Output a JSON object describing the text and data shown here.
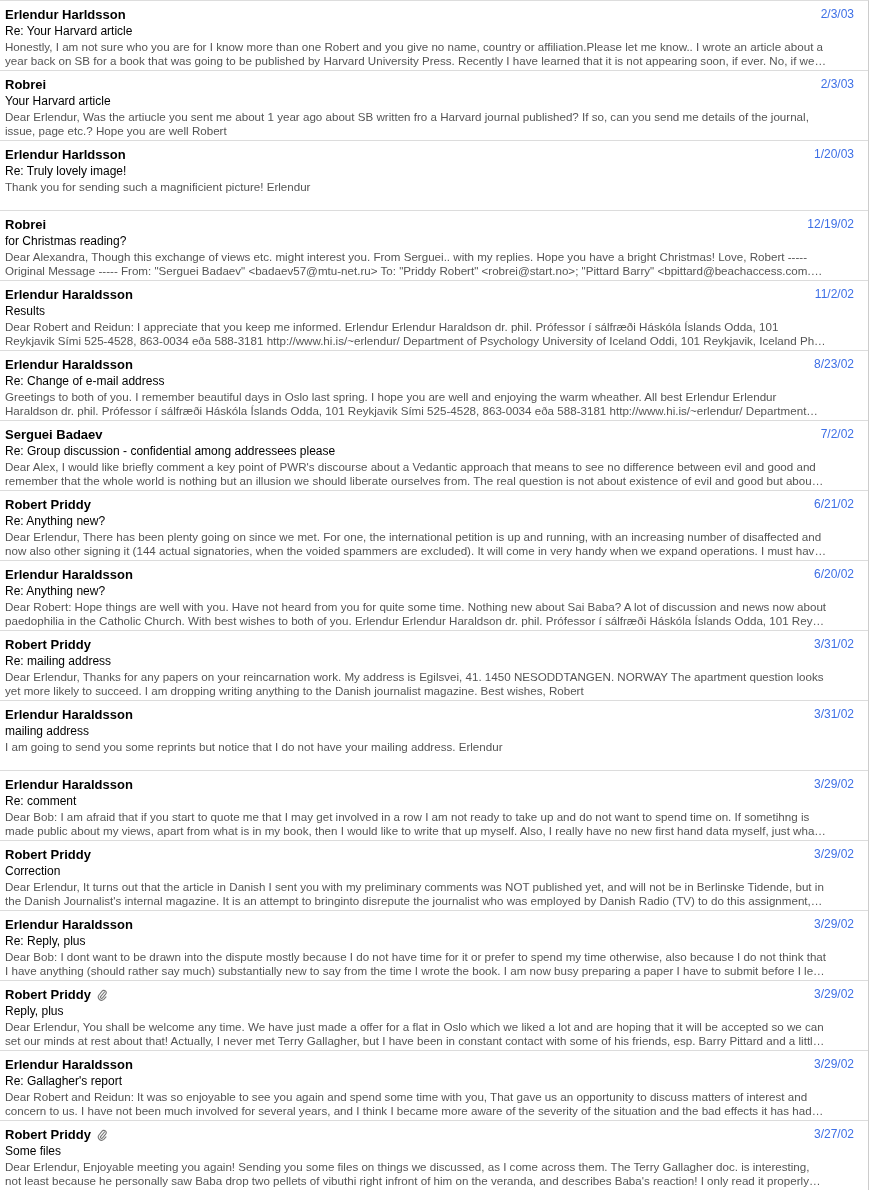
{
  "messages": [
    {
      "sender": "Erlendur Harldsson",
      "attachment": false,
      "date": "2/3/03",
      "subject": "Re: Your Harvard article",
      "preview": [
        "Honestly, I am not sure who you are for I know more than one Robert and you give no name, country or affiliation.Please let me know.. I wrote an article about a",
        "year back on SB for a book that was going to be published by Harvard University Press. Recently I have learned that it is not appearing soon, if ever. No, if we…"
      ]
    },
    {
      "sender": "Robrei",
      "attachment": false,
      "date": "2/3/03",
      "subject": "Your Harvard article",
      "preview": [
        "Dear Erlendur, Was the artiucle you sent me about 1 year ago about SB written fro a Harvard journal published? If so, can you send me details of the journal,",
        "issue, page etc.? Hope you are well Robert"
      ]
    },
    {
      "sender": "Erlendur Harldsson",
      "attachment": false,
      "date": "1/20/03",
      "subject": "Re: Truly lovely image!",
      "preview": [
        "Thank you for sending such a magnificient picture! Erlendur"
      ]
    },
    {
      "sender": "Robrei",
      "attachment": false,
      "date": "12/19/02",
      "subject": "for Christmas reading?",
      "preview": [
        "Dear Alexandra, Though this exchange of views etc. might interest you. From Serguei.. with my replies. Hope you have a bright Christmas! Love, Robert -----",
        "Original Message ----- From: \"Serguei Badaev\" <badaev57@mtu-net.ru> To: \"Priddy Robert\" <robrei@start.no>; \"Pittard Barry\" <bpittard@beachaccess.com.…"
      ]
    },
    {
      "sender": "Erlendur Haraldsson",
      "attachment": false,
      "date": "11/2/02",
      "subject": "Results",
      "preview": [
        "Dear Robert and Reidun: I appreciate that you keep me informed. Erlendur Erlendur Haraldson dr. phil. Prófessor í sálfræði Háskóla Íslands Odda, 101",
        "Reykjavik Sími 525-4528, 863-0034 eða 588-3181 http://www.hi.is/~erlendur/ Department of Psychology University of Iceland Oddi, 101 Reykjavik, Iceland Ph…"
      ]
    },
    {
      "sender": "Erlendur Haraldsson",
      "attachment": false,
      "date": "8/23/02",
      "subject": "Re: Change of e-mail address",
      "preview": [
        "Greetings to both of you. I remember beautiful days in Oslo last spring. I hope you are well and enjoying the warm wheather. All best Erlendur Erlendur",
        "Haraldson dr. phil. Prófessor í sálfræði Háskóla Íslands Odda, 101 Reykjavik Sími 525-4528, 863-0034 eða 588-3181 http://www.hi.is/~erlendur/ Department…"
      ]
    },
    {
      "sender": "Serguei Badaev",
      "attachment": false,
      "date": "7/2/02",
      "subject": "Re: Group discussion - confidential among addressees please",
      "preview": [
        "Dear Alex, I would like briefly comment a key point of PWR's discourse about a Vedantic approach that means to see no difference between evil and good and",
        "remember that the whole world is nothing but an illusion we should liberate ourselves from. The real question is not about existence of evil and good but abou…"
      ]
    },
    {
      "sender": "Robert Priddy",
      "attachment": false,
      "date": "6/21/02",
      "subject": "Re: Anything new?",
      "preview": [
        "Dear Erlendur, There has been plenty going on since we met. For one, the international petition is up and running, with an increasing number of disaffected and",
        "now also other signing it (144 actual signatories, when the voided spammers are excluded). It will come in very handy when we expand operations. I must hav…"
      ]
    },
    {
      "sender": "Erlendur Haraldsson",
      "attachment": false,
      "date": "6/20/02",
      "subject": "Re: Anything new?",
      "preview": [
        "Dear Robert: Hope things are well with you. Have not heard from you for quite some time. Nothing new about Sai Baba? A lot of discussion and news now about",
        "paedophilia in the Catholic Church. With best wishes to both of you. Erlendur Erlendur Haraldson dr. phil. Prófessor í sálfræði Háskóla Íslands Odda, 101 Rey…"
      ]
    },
    {
      "sender": "Robert Priddy",
      "attachment": false,
      "date": "3/31/02",
      "subject": "Re: mailing address",
      "preview": [
        "Dear Erlendur, Thanks for any papers on your reincarnation work. My address is Egilsvei, 41. 1450 NESODDTANGEN. NORWAY The apartment question looks",
        "yet more likely to succeed. I am dropping writing anything to the Danish journalist magazine. Best wishes, Robert"
      ]
    },
    {
      "sender": "Erlendur Haraldsson",
      "attachment": false,
      "date": "3/31/02",
      "subject": "mailing address",
      "preview": [
        "I am going to send you some reprints but notice that I do not have your mailing address. Erlendur"
      ]
    },
    {
      "sender": "Erlendur Haraldsson",
      "attachment": false,
      "date": "3/29/02",
      "subject": "Re: comment",
      "preview": [
        "Dear Bob: I am afraid that if you start to quote me that I may get involved in a row I am not ready to take up and do not want to spend time on. If sometihng is",
        "made public about my views, apart from what is in my book, then I would like to write that up myself. Also, I really have no new first hand data myself, just wha…"
      ]
    },
    {
      "sender": "Robert Priddy",
      "attachment": false,
      "date": "3/29/02",
      "subject": "Correction",
      "preview": [
        "Dear Erlendur, It turns out that the article in Danish I sent you with my preliminary comments was NOT published yet, and will not be in Berlinske Tidende, but in",
        "the Danish Journalist's internal magazine. It is an attempt to bringinto disrepute the journalist who was employed by Danish Radio (TV) to do this assignment,…"
      ]
    },
    {
      "sender": "Erlendur Haraldsson",
      "attachment": false,
      "date": "3/29/02",
      "subject": "Re: Reply, plus",
      "preview": [
        "Dear Bob: I dont want to be drawn into the dispute mostly because I do not have time for it or prefer to spend my time otherwise, also because I do not think that",
        "I have anything (should rather say much) substantially new to say from the time I wrote the book. I am now busy preparing a paper I have to submit before I le…"
      ]
    },
    {
      "sender": "Robert Priddy",
      "attachment": true,
      "date": "3/29/02",
      "subject": "Reply, plus",
      "preview": [
        "Dear Erlendur, You shall be welcome any time. We have just made a offer for a flat in Oslo which we liked a lot and are hoping that it will be accepted so we can",
        "set our minds at rest about that! Actually, I never met Terry Gallagher, but I have been in constant contact with some of his friends, esp. Barry Pittard and a littl…"
      ]
    },
    {
      "sender": "Erlendur Haraldsson",
      "attachment": false,
      "date": "3/29/02",
      "subject": "Re: Gallagher's report",
      "preview": [
        "Dear Robert and Reidun: It was so enjoyable to see you again and spend some time with you, That gave us an opportunity to discuss matters of interest and",
        "concern to us. I have not been much involved for several years, and I think I became more aware of the severity of the situation and the bad effects it has had…"
      ]
    },
    {
      "sender": "Robert Priddy",
      "attachment": true,
      "date": "3/27/02",
      "subject": "Some files",
      "preview": [
        "Dear Erlendur, Enjoyable meeting you again! Sending you some files on things we discussed, as I come across them. The Terry Gallagher doc. is interesting,",
        "not least because he personally saw Baba drop two pellets of vibuthi right infront of him on the veranda, and describes Baba's reaction! I only read it properly…"
      ]
    }
  ]
}
